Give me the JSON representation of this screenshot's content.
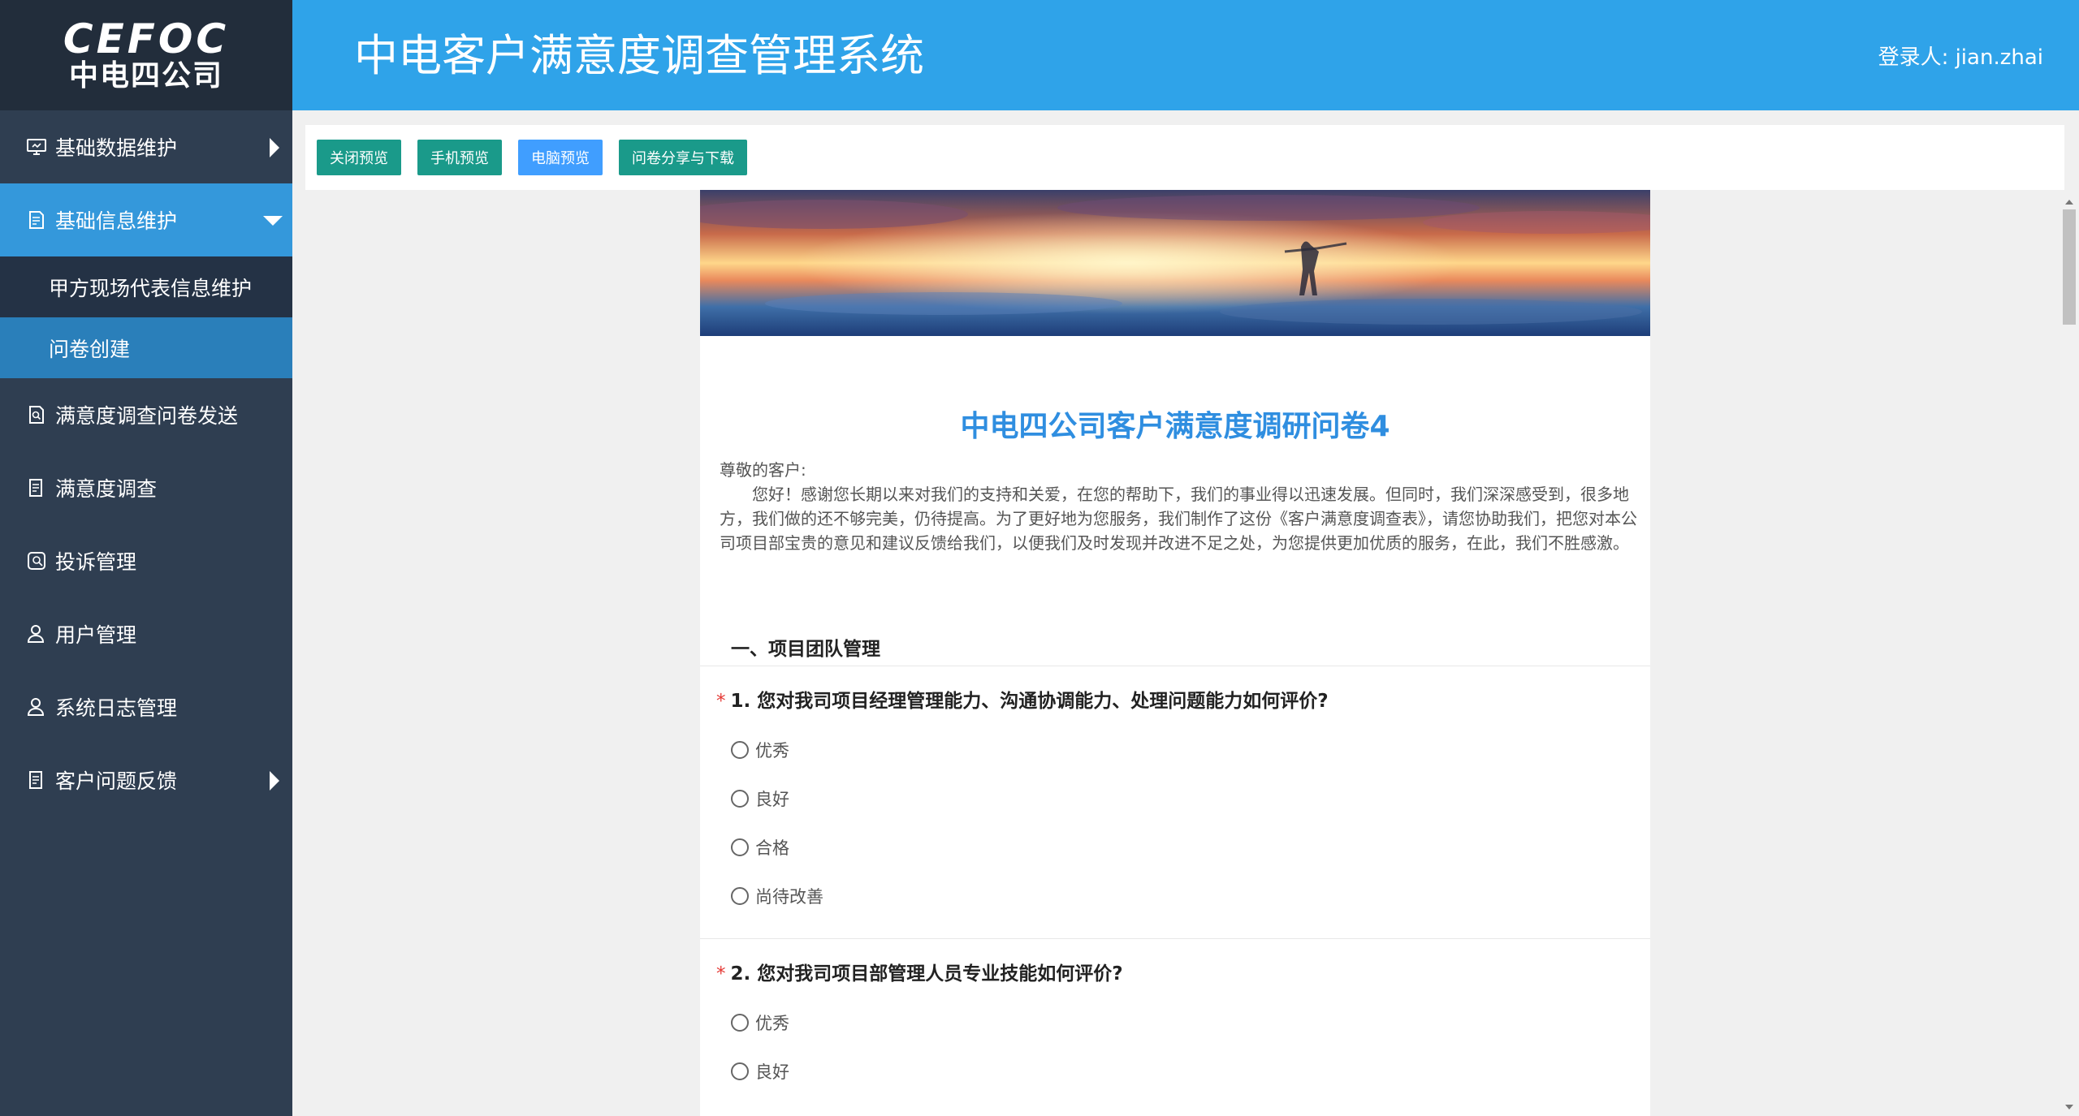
{
  "logo": {
    "en": "CEFOC",
    "cn": "中电四公司"
  },
  "header": {
    "title": "中电客户满意度调查管理系统",
    "user": "登录人: jian.zhai"
  },
  "sidebar": {
    "items": [
      {
        "label": "基础数据维护",
        "icon": "monitor-icon"
      },
      {
        "label": "基础信息维护",
        "icon": "document-edit-icon"
      },
      {
        "label": "满意度调查问卷发送",
        "icon": "document-search-icon"
      },
      {
        "label": "满意度调查",
        "icon": "document-list-icon"
      },
      {
        "label": "投诉管理",
        "icon": "complaint-icon"
      },
      {
        "label": "用户管理",
        "icon": "user-icon"
      },
      {
        "label": "系统日志管理",
        "icon": "user-log-icon"
      },
      {
        "label": "客户问题反馈",
        "icon": "document-list-icon"
      }
    ],
    "subitems": [
      {
        "label": "甲方现场代表信息维护"
      },
      {
        "label": "问卷创建"
      }
    ]
  },
  "toolbar": {
    "close_preview": "关闭预览",
    "mobile_preview": "手机预览",
    "pc_preview": "电脑预览",
    "share_download": "问卷分享与下载"
  },
  "survey": {
    "title": "中电四公司客户满意度调研问卷4",
    "greeting": "尊敬的客户:",
    "intro": "您好！感谢您长期以来对我们的支持和关爱，在您的帮助下，我们的事业得以迅速发展。但同时，我们深深感受到，很多地方，我们做的还不够完美，仍待提高。为了更好地为您服务，我们制作了这份《客户满意度调查表》，请您协助我们，把您对本公司项目部宝贵的意见和建议反馈给我们，以便我们及时发现并改进不足之处，为您提供更加优质的服务，在此，我们不胜感激。",
    "section": "一、项目团队管理",
    "questions": [
      {
        "required": "*",
        "text": "1.  您对我司项目经理管理能力、沟通协调能力、处理问题能力如何评价?",
        "options": [
          "优秀",
          "良好",
          "合格",
          "尚待改善"
        ]
      },
      {
        "required": "*",
        "text": "2.  您对我司项目部管理人员专业技能如何评价?",
        "options": [
          "优秀",
          "良好"
        ]
      }
    ]
  },
  "colors": {
    "sidebar": "#2f3e51",
    "header": "#2fa3e9",
    "active": "#3498db",
    "btn_green": "#1a9a8a",
    "btn_blue": "#409eff",
    "title_blue": "#2f8ee0"
  }
}
